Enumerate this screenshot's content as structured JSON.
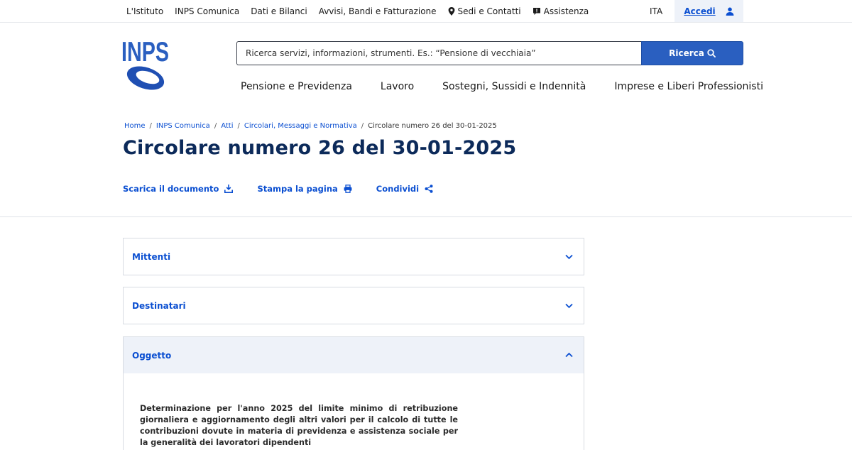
{
  "topbar": {
    "links": [
      "L'Istituto",
      "INPS Comunica",
      "Dati e Bilanci",
      "Avvisi, Bandi e Fatturazione"
    ],
    "sedi_label": "Sedi e Contatti",
    "assistenza_label": "Assistenza",
    "language": "ITA",
    "login_label": "Accedi"
  },
  "header": {
    "logo_text": "INPS",
    "search_placeholder": "Ricerca servizi, informazioni, strumenti. Es.: “Pensione di vecchiaia”",
    "search_button": "Ricerca",
    "nav": [
      "Pensione e Previdenza",
      "Lavoro",
      "Sostegni, Sussidi e Indennità",
      "Imprese e Liberi Professionisti"
    ]
  },
  "breadcrumb": {
    "items": [
      "Home",
      "INPS Comunica",
      "Atti",
      "Circolari, Messaggi e Normativa"
    ],
    "separator": "/",
    "current": "Circolare numero 26 del 30-01-2025"
  },
  "page": {
    "title": "Circolare numero 26 del 30-01-2025",
    "actions": {
      "download": "Scarica il documento",
      "print": "Stampa la pagina",
      "share": "Condividi"
    }
  },
  "accordions": [
    {
      "label": "Mittenti",
      "expanded": false
    },
    {
      "label": "Destinatari",
      "expanded": false
    },
    {
      "label": "Oggetto",
      "expanded": true
    }
  ],
  "oggetto_text": "Determinazione per l'anno 2025 del limite minimo di retribuzione giornaliera e aggiornamento degli altri valori per il calcolo di tutte le contribuzioni dovute in materia di previdenza e assistenza sociale per la generalità dei lavoratori dipendenti",
  "colors": {
    "brand_blue": "#0b4fd1",
    "title_navy": "#0c2a5a",
    "search_button": "#2a5fc0",
    "accent_bg": "#eef2f9"
  },
  "icons": {
    "sedi": "map-pin-icon",
    "assistenza": "chat-icon",
    "login": "user-icon",
    "search": "search-icon",
    "download": "download-icon",
    "print": "printer-icon",
    "share": "share-icon",
    "collapsed": "chevron-down-icon",
    "expanded": "chevron-up-icon"
  }
}
